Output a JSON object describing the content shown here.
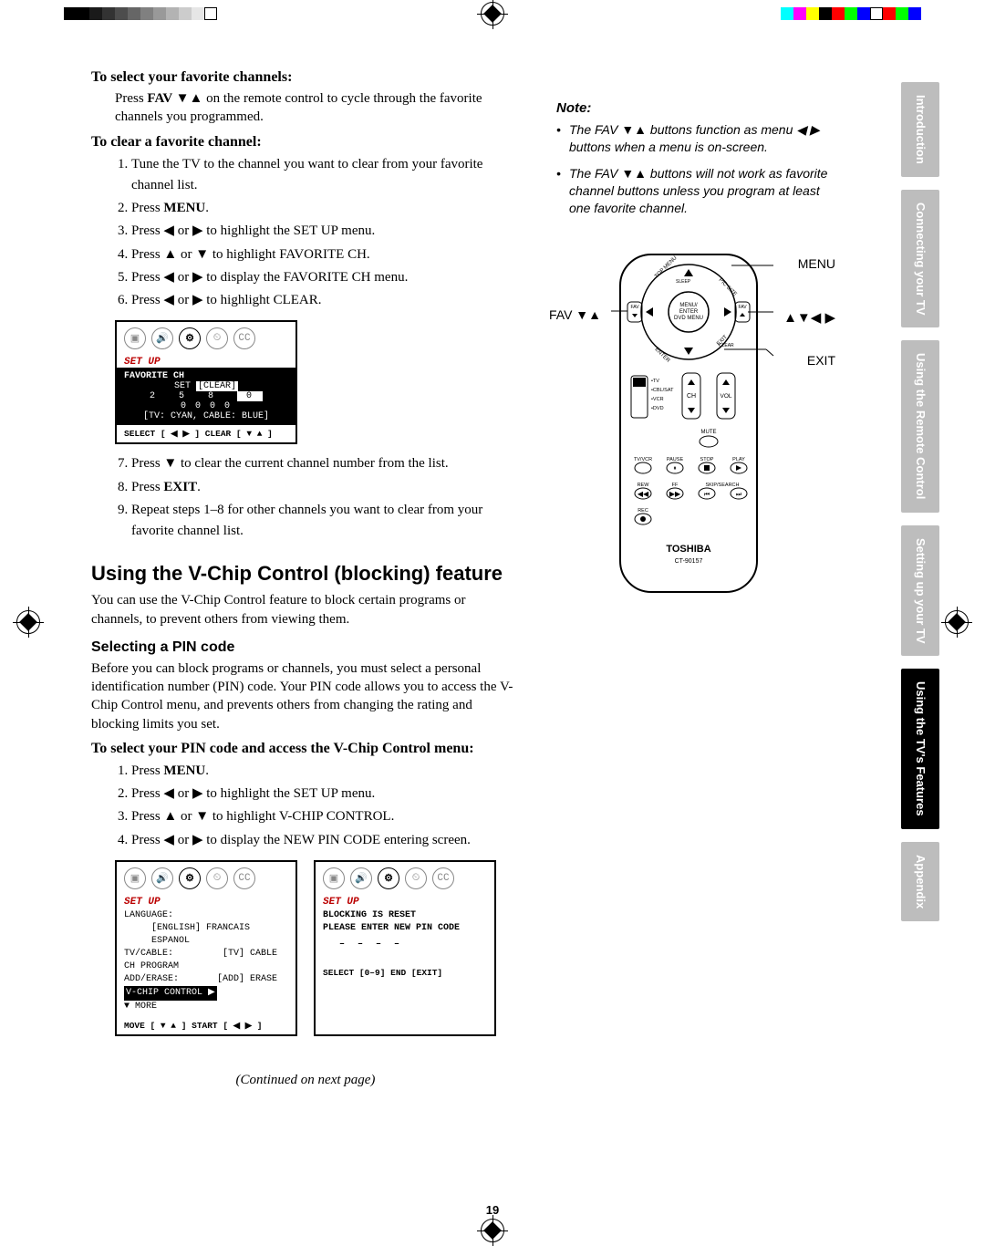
{
  "sections": {
    "select_fav_head": "To select your favorite channels:",
    "select_fav_body_1": "Press ",
    "select_fav_bold": "FAV ▼▲",
    "select_fav_body_2": " on the remote control to cycle through the favorite channels you programmed.",
    "clear_fav_head": "To clear a favorite channel:",
    "clear_steps": [
      "Tune the TV to the channel you want to clear from your favorite channel list.",
      "Press MENU.",
      "Press ◀ or ▶ to highlight the SET UP menu.",
      "Press ▲ or ▼ to highlight FAVORITE CH.",
      "Press ◀ or ▶ to display the FAVORITE CH menu.",
      "Press ◀ or ▶ to highlight CLEAR."
    ],
    "clear_steps_after": [
      "Press ▼ to clear the current channel number from the list.",
      "Press EXIT.",
      "Repeat steps 1–8 for other channels you want to clear from your favorite channel list."
    ],
    "vchip_head": "Using the V-Chip Control (blocking) feature",
    "vchip_para": "You can use the V-Chip Control feature to block certain programs or channels, to prevent others from viewing them.",
    "pin_head": "Selecting a PIN code",
    "pin_para": "Before you can block programs or channels, you must select a personal identification number (PIN) code. Your PIN code allows you to access the V-Chip Control menu, and prevents others from changing the rating and blocking limits you set.",
    "pin_steps_head": "To select your PIN code and access the V-Chip Control menu:",
    "pin_steps": [
      "Press MENU.",
      "Press ◀ or ▶ to highlight the SET UP menu.",
      "Press ▲ or ▼ to highlight V-CHIP CONTROL.",
      "Press ◀ or ▶ to display the NEW PIN CODE entering screen."
    ],
    "continued": "(Continued on next page)"
  },
  "osd1": {
    "title": "SET UP",
    "row1": "FAVORITE CH",
    "row2_a": "SET",
    "row2_b": "[CLEAR]",
    "nums1": "2   5   8   0",
    "nums2": "0   0   0   0",
    "line": "[TV: CYAN,  CABLE: BLUE]",
    "foot": "SELECT [ ◀  ▶ ]     CLEAR [ ▼ ▲ ]"
  },
  "osd2": {
    "title": "SET UP",
    "l1": "LANGUAGE:",
    "l1v": "[ENGLISH] FRANCAIS ESPANOL",
    "l2": "TV/CABLE:",
    "l2v": "[TV] CABLE",
    "l3": "CH PROGRAM",
    "l4": "ADD/ERASE:",
    "l4v": "[ADD] ERASE",
    "hl": "V-CHIP CONTROL   ▶",
    "more": "▼ MORE",
    "foot": "MOVE [ ▼ ▲ ]     START [ ◀  ▶ ]"
  },
  "osd3": {
    "title": "SET UP",
    "l1": "BLOCKING IS RESET",
    "l2": "PLEASE ENTER NEW PIN CODE",
    "dashes": "– – – –",
    "foot": "SELECT [0–9]   END [EXIT]"
  },
  "note": {
    "head": "Note:",
    "items": [
      "The FAV ▼▲ buttons function as menu ◀ ▶ buttons when a menu is on-screen.",
      "The FAV ▼▲ buttons will not work as favorite channel buttons unless you program at least one favorite channel."
    ]
  },
  "callouts": {
    "menu": "MENU",
    "arrows": "▲▼◀ ▶",
    "exit": "EXIT",
    "fav": "FAV ▼▲"
  },
  "remote": {
    "brand": "TOSHIBA",
    "model": "CT-90157",
    "center_labels": "MENU/\nENTER\nDVD MENU",
    "fav_label": "FAV",
    "switch_labels": "•TV\n•CBL/SAT\n•VCR\n•DVD",
    "ch": "CH",
    "vol": "VOL",
    "mute": "MUTE",
    "row1": [
      "TV/VCR",
      "PAUSE",
      "STOP",
      "PLAY"
    ],
    "row2": [
      "REW",
      "FF",
      "SKIP/SEARCH",
      ""
    ],
    "rec": "REC"
  },
  "tabs": [
    "Introduction",
    "Connecting your TV",
    "Using the Remote Control",
    "Setting up your TV",
    "Using the TV's Features",
    "Appendix"
  ],
  "page_number": "19"
}
